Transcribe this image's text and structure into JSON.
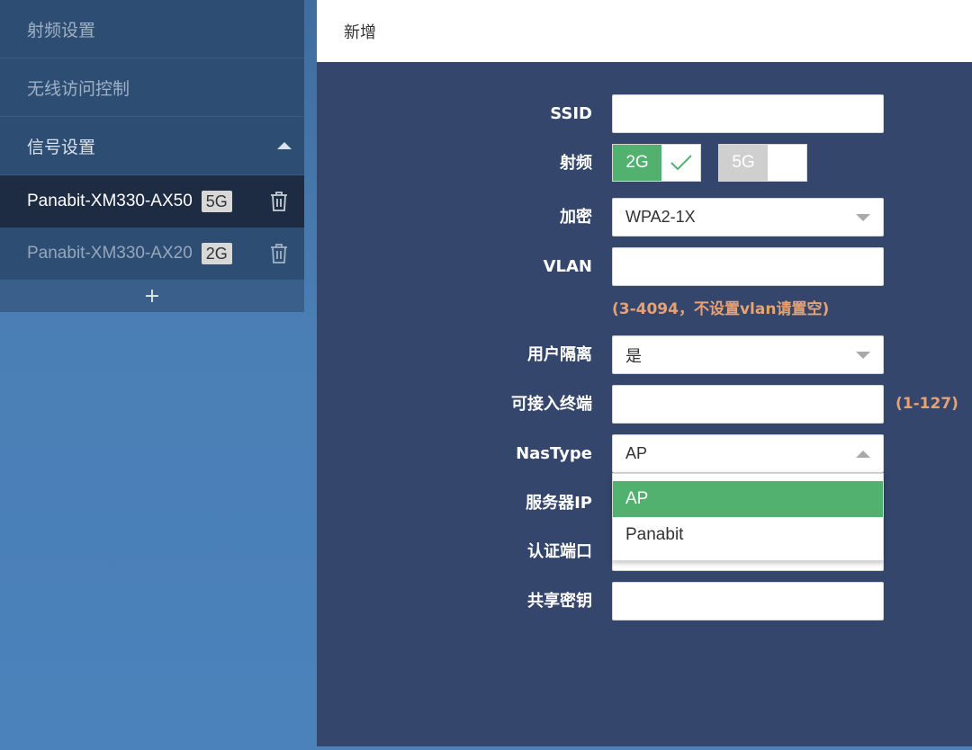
{
  "sidebar": {
    "items": [
      {
        "label": "射频设置"
      },
      {
        "label": "无线访问控制"
      },
      {
        "label": "信号设置"
      }
    ],
    "ssids": [
      {
        "name": "Panabit-XM330-AX50",
        "band": "5G"
      },
      {
        "name": "Panabit-XM330-AX20",
        "band": "2G"
      }
    ],
    "add_label": "+"
  },
  "panel": {
    "title": "新增",
    "form": {
      "ssid_label": "SSID",
      "ssid_value": "",
      "band_label": "射频",
      "band_2g": "2G",
      "band_5g": "5G",
      "encrypt_label": "加密",
      "encrypt_value": "WPA2-1X",
      "vlan_label": "VLAN",
      "vlan_value": "",
      "vlan_hint": "(3-4094，不设置vlan请置空)",
      "isolation_label": "用户隔离",
      "isolation_value": "是",
      "max_clients_label": "可接入终端",
      "max_clients_value": "",
      "max_clients_hint": "(1-127)",
      "nastype_label": "NasType",
      "nastype_value": "AP",
      "nastype_options": [
        "AP",
        "Panabit"
      ],
      "server_ip_label": "服务器IP",
      "auth_port_label": "认证端口",
      "shared_key_label": "共享密钥",
      "shared_key_value": ""
    }
  },
  "colors": {
    "panel_bg": "#34466c",
    "accent_green": "#52b16f",
    "hint_orange": "#e7a173"
  }
}
